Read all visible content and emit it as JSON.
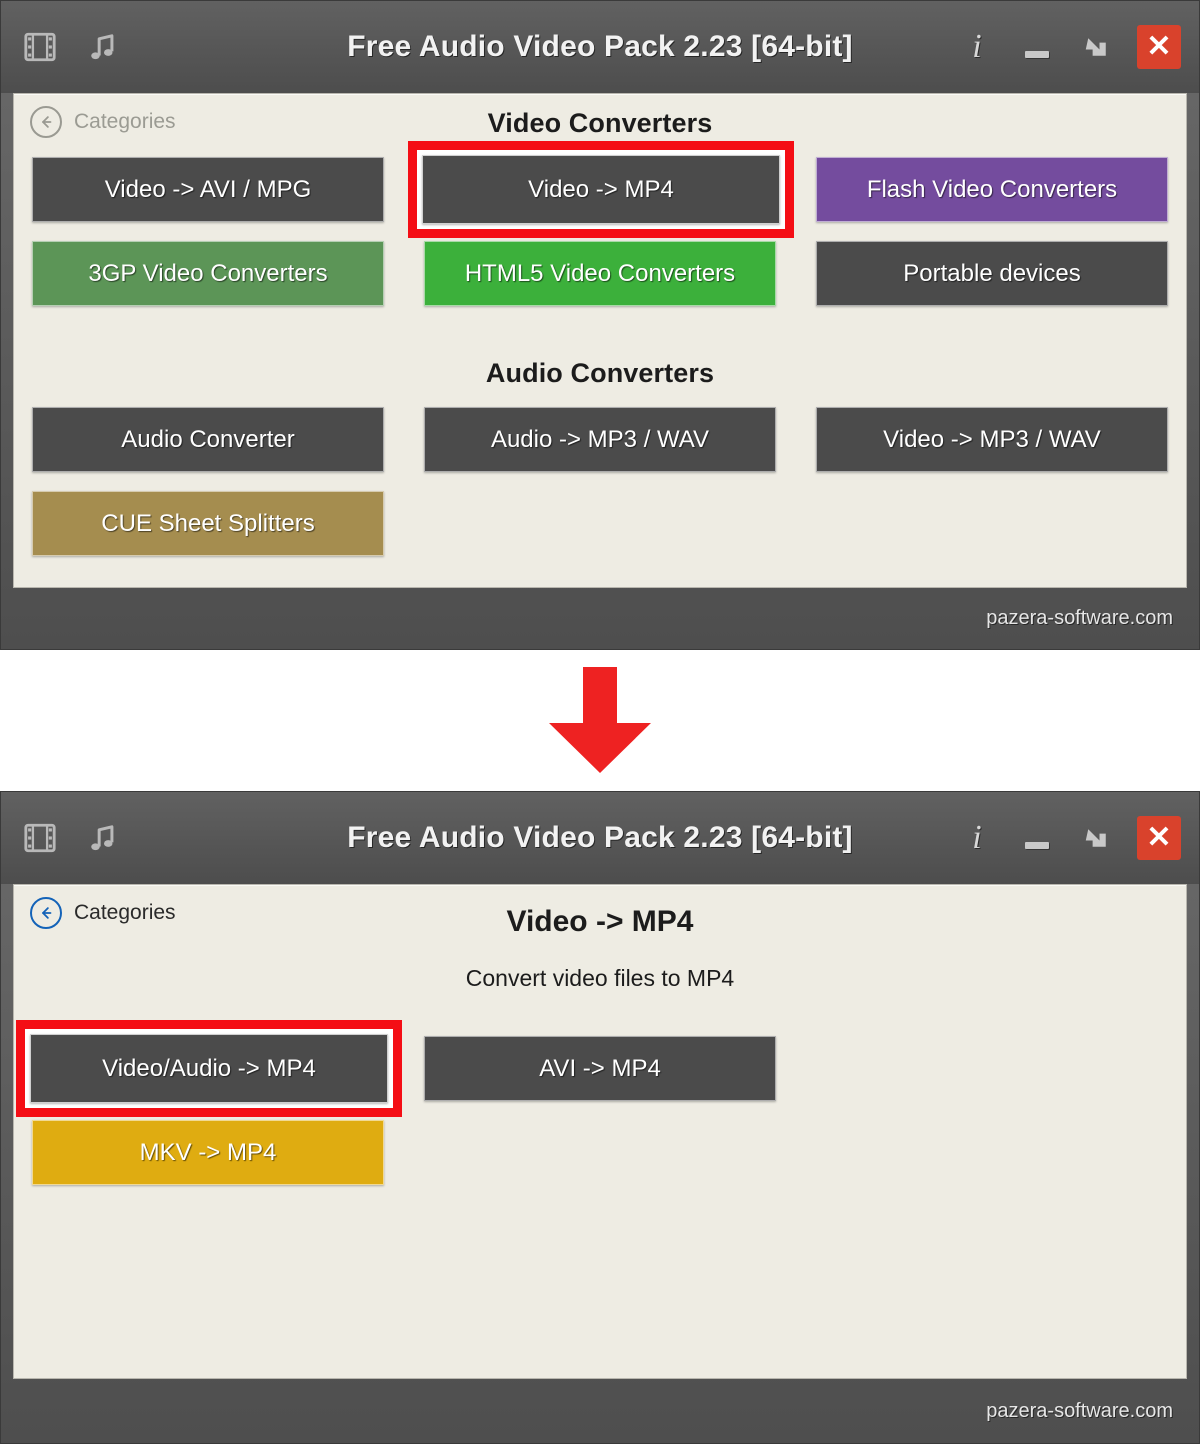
{
  "window": {
    "title": "Free Audio Video Pack 2.23 [64-bit]",
    "footer": "pazera-software.com",
    "icons": {
      "film": "film-strip-icon",
      "note": "music-note-icon",
      "info": "i",
      "minimize": "minimize-icon",
      "tray": "minimize-to-tray-icon",
      "close": "✕"
    },
    "accent_close": "#d9422c"
  },
  "top_screen": {
    "back_label": "Categories",
    "sections": [
      {
        "heading": "Video Converters",
        "buttons": [
          {
            "label": "Video -> AVI / MPG",
            "style": "dark",
            "color": "#4b4b4b",
            "highlighted": false
          },
          {
            "label": "Video -> MP4",
            "style": "dark",
            "color": "#4b4b4b",
            "highlighted": true
          },
          {
            "label": "Flash Video Converters",
            "style": "purple",
            "color": "#744c9e",
            "highlighted": false
          },
          {
            "label": "3GP Video Converters",
            "style": "green",
            "color": "#5c9557",
            "highlighted": false
          },
          {
            "label": "HTML5 Video Converters",
            "style": "green2",
            "color": "#3cb03b",
            "highlighted": false
          },
          {
            "label": "Portable devices",
            "style": "dark",
            "color": "#4b4b4b",
            "highlighted": false
          }
        ]
      },
      {
        "heading": "Audio Converters",
        "buttons": [
          {
            "label": "Audio Converter",
            "style": "dark",
            "color": "#4b4b4b",
            "highlighted": false
          },
          {
            "label": "Audio -> MP3 / WAV",
            "style": "dark",
            "color": "#4b4b4b",
            "highlighted": false
          },
          {
            "label": "Video -> MP3 / WAV",
            "style": "dark",
            "color": "#4b4b4b",
            "highlighted": false
          },
          {
            "label": "CUE Sheet Splitters",
            "style": "gold",
            "color": "#a58d4f",
            "highlighted": false
          }
        ]
      }
    ]
  },
  "bottom_screen": {
    "back_label": "Categories",
    "title": "Video -> MP4",
    "subtitle": "Convert video files to MP4",
    "buttons": [
      {
        "label": "Video/Audio -> MP4",
        "style": "dark",
        "color": "#4b4b4b",
        "highlighted": true
      },
      {
        "label": "AVI -> MP4",
        "style": "dark",
        "color": "#4b4b4b",
        "highlighted": false
      },
      {
        "label": "MKV -> MP4",
        "style": "amber",
        "color": "#dfac11",
        "highlighted": false
      }
    ]
  },
  "divider": {
    "arrow": "down-arrow",
    "color": "#ee2222"
  }
}
